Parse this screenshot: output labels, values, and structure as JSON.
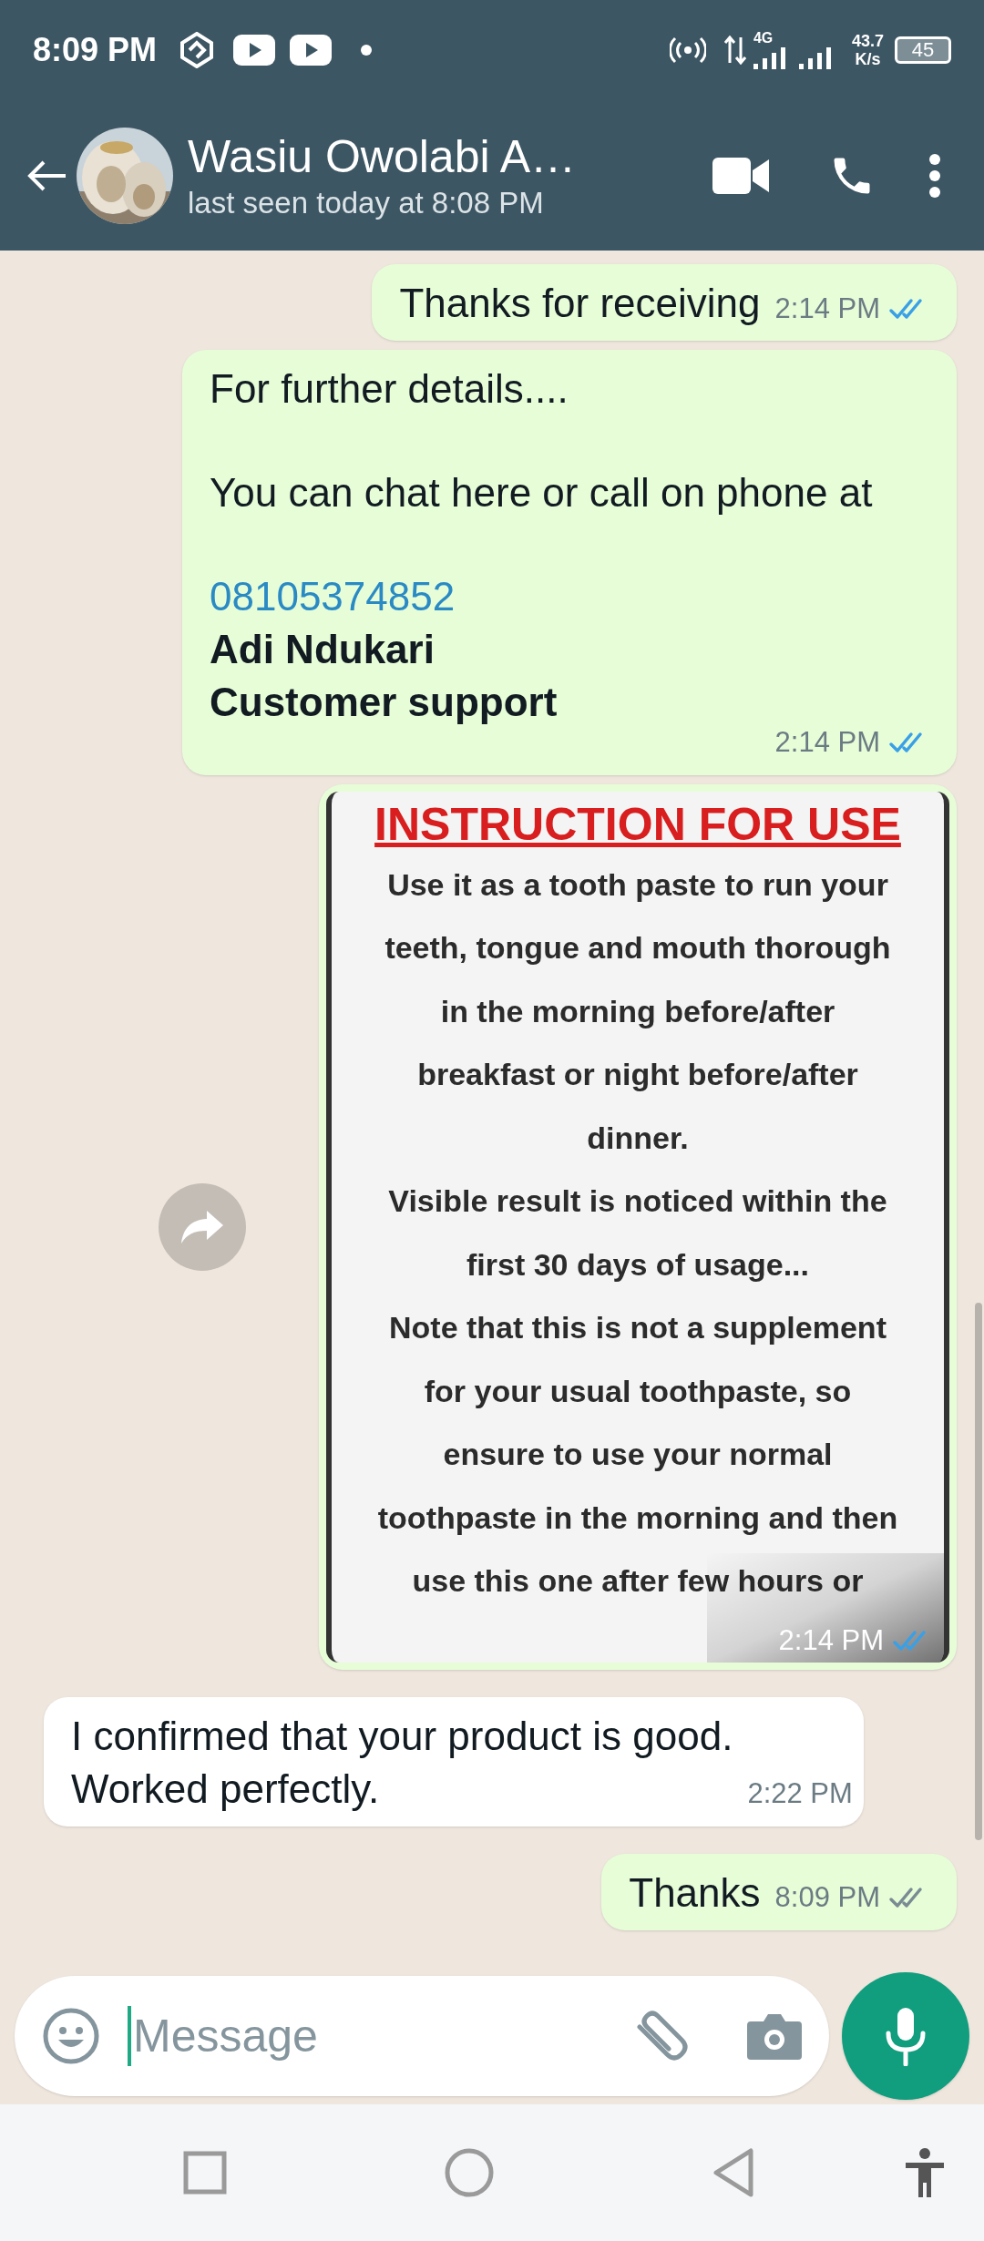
{
  "status_bar": {
    "time": "8:09 PM",
    "network": "4G",
    "speed": "43.7",
    "speed_unit": "K/s",
    "battery": "45"
  },
  "header": {
    "name": "Wasiu Owolabi A…",
    "subtitle": "last seen today at 8:08 PM"
  },
  "messages": [
    {
      "kind": "text",
      "incoming": false,
      "text": "Thanks for receiving",
      "time": "2:14 PM",
      "read": true
    },
    {
      "kind": "rich",
      "incoming": false,
      "lines": [
        {
          "kind": "plain",
          "text": "For further details...."
        },
        {
          "kind": "gap"
        },
        {
          "kind": "plain",
          "text": "You can chat here or call on phone at"
        },
        {
          "kind": "gap"
        },
        {
          "kind": "link",
          "text": "08105374852"
        },
        {
          "kind": "bold",
          "text": "Adi Ndukari"
        },
        {
          "kind": "bold",
          "text": "Customer support"
        }
      ],
      "time": "2:14 PM",
      "read": true
    },
    {
      "incoming": false,
      "title": "INSTRUCTION FOR USE",
      "lines": [
        "Use it as a tooth paste to run your",
        "teeth, tongue and mouth thorough",
        "in the morning before/after",
        "breakfast or night before/after",
        "dinner.",
        "Visible result is noticed within the",
        "first 30 days of usage...",
        "Note that this is not a supplement",
        "for your usual toothpaste, so",
        "ensure to use your normal",
        "toothpaste in the morning and then",
        "use this one after few hours or"
      ],
      "time": "2:14 PM",
      "read": true
    },
    {
      "kind": "text",
      "incoming": true,
      "lines": [
        "I confirmed that your product is good.",
        "Worked perfectly."
      ],
      "time": "2:22 PM"
    },
    {
      "kind": "text",
      "incoming": false,
      "text": "Thanks",
      "time": "8:09 PM",
      "read": false
    }
  ],
  "composer": {
    "placeholder": "Message"
  }
}
